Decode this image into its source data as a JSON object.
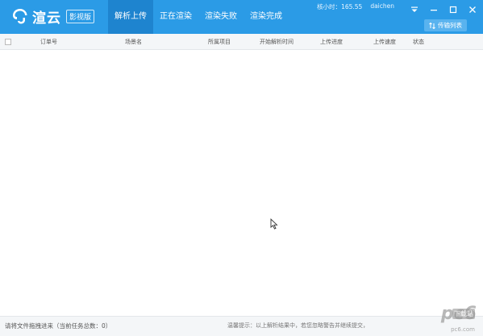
{
  "header": {
    "brand": "渲云",
    "edition": "影视版",
    "tabs": [
      {
        "label": "解析上传",
        "active": true
      },
      {
        "label": "正在渲染",
        "active": false
      },
      {
        "label": "渲染失败",
        "active": false
      },
      {
        "label": "渲染完成",
        "active": false
      }
    ],
    "balance_label": "核小时：",
    "balance_value": "165.55",
    "username": "daichen",
    "transfer_list_label": "传输列表"
  },
  "table": {
    "columns": [
      "订单号",
      "场景名",
      "所属项目",
      "开始解析时间",
      "上传进度",
      "上传速度",
      "状态"
    ],
    "rows": []
  },
  "footer": {
    "drop_hint": "请将文件拖拽进来（当前任务总数：0）",
    "warm_tip": "温馨提示：以上解析结果中，若您忽略警告并继续提交，"
  },
  "watermark": {
    "text": "pc6",
    "badge": "下载站",
    "url": "pc6.com"
  },
  "colors": {
    "header_bg": "#2b9be6",
    "active_tab": "#1e84cf",
    "table_header_bg": "#f4f6f8"
  }
}
